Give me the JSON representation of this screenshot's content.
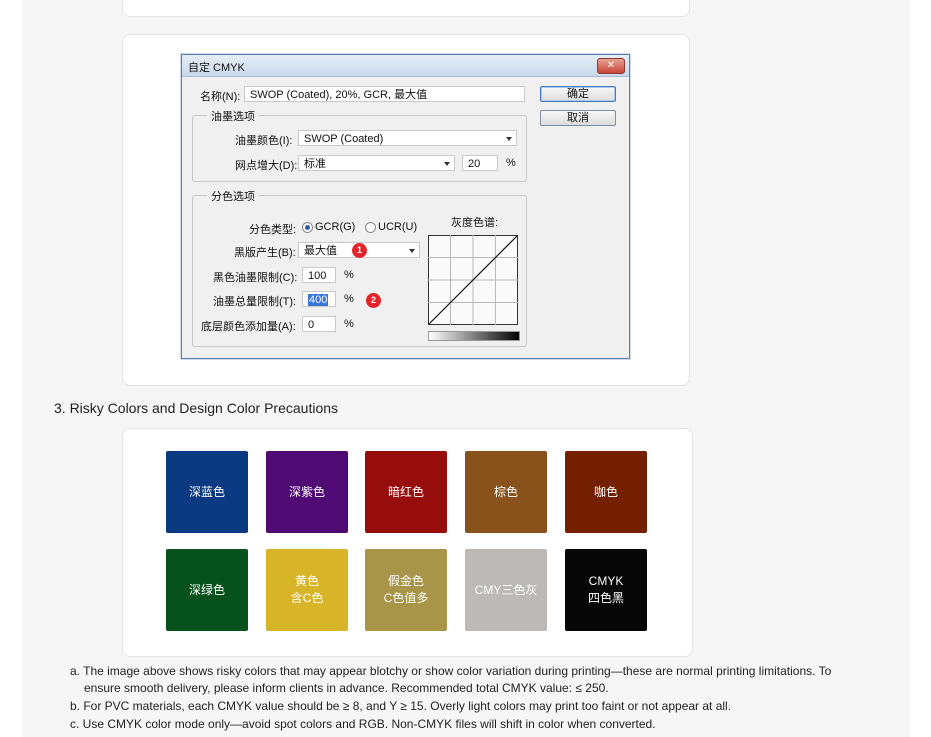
{
  "dialog": {
    "title": "自定 CMYK",
    "close_label": "✕",
    "name_label": "名称(N):",
    "name_value": "SWOP (Coated), 20%, GCR, 最大值",
    "ok_label": "确定",
    "cancel_label": "取消",
    "ink_options": {
      "title": "油墨选项",
      "ink_colors_label": "油墨颜色(I):",
      "ink_colors_value": "SWOP (Coated)",
      "dot_gain_label": "网点增大(D):",
      "dot_gain_mode": "标准",
      "dot_gain_value": "20",
      "dot_gain_unit": "%"
    },
    "separation_options": {
      "title": "分色选项",
      "separation_type_label": "分色类型:",
      "gcr_label": "GCR(G)",
      "ucr_label": "UCR(U)",
      "gray_ramp_label": "灰度色谱:",
      "black_generation_label": "黑版产生(B):",
      "black_generation_value": "最大值",
      "marker_1": "1",
      "black_ink_limit_label": "黑色油墨限制(C):",
      "black_ink_limit_value": "100",
      "black_ink_limit_unit": "%",
      "total_ink_limit_label": "油墨总量限制(T):",
      "total_ink_limit_value": "400",
      "total_ink_limit_unit": "%",
      "marker_2": "2",
      "ucr_amount_label": "底层颜色添加量(A):",
      "ucr_amount_value": "0",
      "ucr_amount_unit": "%"
    }
  },
  "heading": "3. Risky Colors and Design Color Precautions",
  "swatches": [
    {
      "label": "深蓝色",
      "color": "#0b3a82"
    },
    {
      "label": "深紫色",
      "color": "#4f0a74"
    },
    {
      "label": "暗红色",
      "color": "#970d0b"
    },
    {
      "label": "棕色",
      "color": "#8a521b"
    },
    {
      "label": "咖色",
      "color": "#731f00"
    },
    {
      "label": "深绿色",
      "color": "#07521c"
    },
    {
      "label": "黄色\n含C色",
      "color": "#d8b429"
    },
    {
      "label": "假金色\nC色值多",
      "color": "#a89548"
    },
    {
      "label": "CMY三色灰",
      "color": "#bcb9b6"
    },
    {
      "label": "CMYK\n四色黑",
      "color": "#070707"
    }
  ],
  "notes": [
    "a. The image above shows risky colors that may appear blotchy or show color variation during printing—these are normal printing limitations. To",
    "ensure smooth delivery, please inform clients in advance.  Recommended total CMYK value: ≤ 250.",
    "b. For PVC materials, each CMYK value should be ≥ 8, and Y ≥ 15. Overly light colors may print too faint or not appear at all.",
    "c. Use CMYK color mode only—avoid spot colors and RGB. Non-CMYK files will shift in color when converted."
  ]
}
